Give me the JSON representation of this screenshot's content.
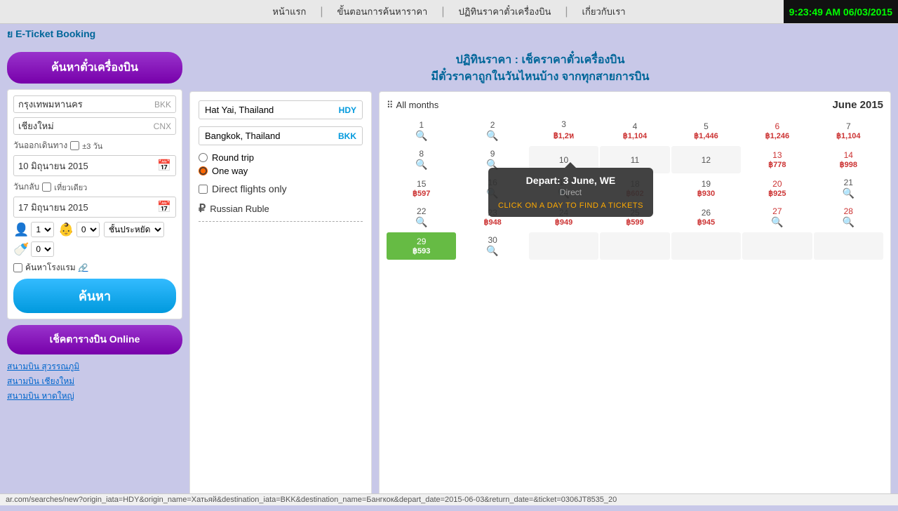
{
  "topnav": {
    "links": [
      "หน้าแรก",
      "ขั้นตอนการค้นหาราคา",
      "ปฏิทินราคาตั๋วเครื่องบิน",
      "เกี่ยวกับเรา"
    ],
    "clock": "9:23:49 AM 06/03/2015"
  },
  "header_bar": "E-Ticket Booking",
  "sidebar": {
    "search_flights_btn": "ค้นหาตั๋วเครื่องบิน",
    "origin": {
      "value": "กรุงเทพมหานคร",
      "code": "BKK"
    },
    "destination": {
      "value": "เชียงใหม่",
      "code": "CNX"
    },
    "depart_label": "วันออกเดินทาง",
    "depart_checkbox_label": "±3 วัน",
    "depart_date": "10 มิถุนายน 2015",
    "return_label": "วันกลับ",
    "return_checkbox_label": "เที่ยวเดียว",
    "return_date": "17 มิถุนายน 2015",
    "adult_count": "1",
    "child_count": "0",
    "class_label": "ชั้นประหยัด",
    "infant_count": "0",
    "hotel_label": "ค้นหาโรงแรม",
    "search_btn": "ค้นหา",
    "schedule_btn": "เช็คตารางบิน Online",
    "airport_links": [
      "สนามบิน สุวรรณภูมิ",
      "สนามบิน เชียงใหม่",
      "สนามบิน หาดใหญ่"
    ]
  },
  "content": {
    "header_line1": "ปฏิทินราคา : เช็คราคาตั๋วเครื่องบิน",
    "header_line2": "มีตั๋วราคาถูกในวันไหนบ้าง จากทุกสายการบิน"
  },
  "search_panel": {
    "origin": {
      "value": "Hat Yai, Thailand",
      "code": "HDY"
    },
    "destination": {
      "value": "Bangkok, Thailand",
      "code": "BKK"
    },
    "round_trip_label": "Round trip",
    "one_way_label": "One way",
    "direct_only_label": "Direct flights only",
    "currency_label": "Russian Ruble"
  },
  "calendar": {
    "month_btn_label": "All months",
    "title": "June 2015",
    "days": [
      {
        "num": "1",
        "price": "",
        "type": "search"
      },
      {
        "num": "2",
        "price": "",
        "type": "search"
      },
      {
        "num": "3",
        "price": "฿1,2ห",
        "type": "price"
      },
      {
        "num": "4",
        "price": "฿1,104",
        "type": "price"
      },
      {
        "num": "5",
        "price": "฿1,446",
        "type": "price"
      },
      {
        "num": "6",
        "price": "฿1,246",
        "type": "price_red"
      },
      {
        "num": "7",
        "price": "฿1,104",
        "type": "price"
      },
      {
        "num": "8",
        "price": "",
        "type": "search"
      },
      {
        "num": "9",
        "price": "",
        "type": "search"
      },
      {
        "num": "10",
        "price": "",
        "type": "empty"
      },
      {
        "num": "11",
        "price": "",
        "type": "empty"
      },
      {
        "num": "12",
        "price": "",
        "type": "empty"
      },
      {
        "num": "13",
        "price": "฿778",
        "type": "price_red"
      },
      {
        "num": "14",
        "price": "฿998",
        "type": "price_red"
      },
      {
        "num": "15",
        "price": "฿597",
        "type": "price"
      },
      {
        "num": "16",
        "price": "",
        "type": "search"
      },
      {
        "num": "17",
        "price": "",
        "type": "search"
      },
      {
        "num": "18",
        "price": "฿602",
        "type": "price"
      },
      {
        "num": "19",
        "price": "฿930",
        "type": "price"
      },
      {
        "num": "20",
        "price": "฿925",
        "type": "price_red"
      },
      {
        "num": "21",
        "price": "",
        "type": "search"
      },
      {
        "num": "22",
        "price": "",
        "type": "search"
      },
      {
        "num": "23",
        "price": "฿948",
        "type": "price"
      },
      {
        "num": "24",
        "price": "฿949",
        "type": "price"
      },
      {
        "num": "25",
        "price": "฿599",
        "type": "price"
      },
      {
        "num": "26",
        "price": "฿945",
        "type": "price"
      },
      {
        "num": "27",
        "price": "",
        "type": "search_red"
      },
      {
        "num": "28",
        "price": "",
        "type": "search_red"
      },
      {
        "num": "29",
        "price": "฿593",
        "type": "highlighted"
      },
      {
        "num": "30",
        "price": "",
        "type": "search"
      },
      {
        "num": "",
        "price": "",
        "type": "empty"
      },
      {
        "num": "",
        "price": "",
        "type": "empty"
      },
      {
        "num": "",
        "price": "",
        "type": "empty"
      },
      {
        "num": "",
        "price": "",
        "type": "empty"
      },
      {
        "num": "",
        "price": "",
        "type": "empty"
      }
    ]
  },
  "tooltip": {
    "date_text": "Depart: 3 June, WE",
    "direct_text": "Direct",
    "cta_text": "CLICK ON A DAY TO FIND A TICKETS"
  },
  "url_bar": "ar.com/searches/new?origin_iata=HDY&origin_name=Хатьяй&destination_iata=BKK&destination_name=Бангкок&depart_date=2015-06-03&return_date=&ticket=0306JT8535_20"
}
